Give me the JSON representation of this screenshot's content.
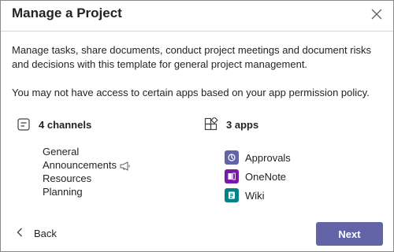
{
  "dialog": {
    "title": "Manage a Project",
    "close_icon": "close-icon",
    "description": "Manage tasks, share documents, conduct project meetings and document risks and decisions with this template for general project management.",
    "permission_note": "You may not have access to certain apps based on your app permission policy."
  },
  "channels": {
    "icon": "channel-list-icon",
    "heading": "4 channels",
    "items": [
      {
        "label": "General"
      },
      {
        "label": "Announcements",
        "icon": "megaphone-icon"
      },
      {
        "label": "Resources"
      },
      {
        "label": "Planning"
      }
    ]
  },
  "apps": {
    "icon": "apps-grid-icon",
    "heading": "3 apps",
    "items": [
      {
        "label": "Approvals",
        "icon": "approvals-icon",
        "color": "#6264a7"
      },
      {
        "label": "OneNote",
        "icon": "onenote-icon",
        "color": "#7719aa"
      },
      {
        "label": "Wiki",
        "icon": "wiki-icon",
        "color": "#038387"
      }
    ]
  },
  "footer": {
    "back_label": "Back",
    "next_label": "Next",
    "accent": "#6264a7"
  }
}
